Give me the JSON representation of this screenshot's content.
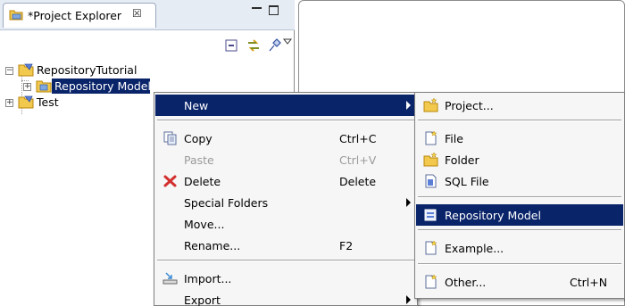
{
  "view": {
    "tab_title": "*Project Explorer",
    "close_glyph": "☒",
    "toolbar": [
      "collapse-all-icon",
      "link-with-editor-icon",
      "pin-icon",
      "view-menu-icon"
    ]
  },
  "tree": {
    "items": [
      {
        "label": "RepositoryTutorial",
        "expander": "−",
        "icon": "project-icon"
      },
      {
        "label": "Repository Models",
        "expander": "+",
        "icon": "folder-icon",
        "selected": true
      },
      {
        "label": "Test",
        "expander": "+",
        "icon": "project-icon"
      }
    ]
  },
  "context_menu": {
    "items": [
      {
        "label": "New",
        "submenu": true,
        "highlighted": true
      },
      {
        "label": "Copy",
        "shortcut": "Ctrl+C",
        "icon": "copy-icon"
      },
      {
        "label": "Paste",
        "shortcut": "Ctrl+V",
        "disabled": true
      },
      {
        "label": "Delete",
        "shortcut": "Delete",
        "icon": "delete-icon"
      },
      {
        "label": "Special Folders",
        "submenu": true
      },
      {
        "label": "Move..."
      },
      {
        "label": "Rename...",
        "shortcut": "F2"
      },
      {
        "label": "Import...",
        "icon": "import-icon"
      },
      {
        "label": "Export",
        "submenu": true
      }
    ]
  },
  "new_submenu": {
    "items": [
      {
        "label": "Project...",
        "icon": "new-project-icon"
      },
      {
        "label": "File",
        "icon": "new-file-icon"
      },
      {
        "label": "Folder",
        "icon": "new-folder-icon"
      },
      {
        "label": "SQL File",
        "icon": "sql-file-icon"
      },
      {
        "label": "Repository Model",
        "icon": "repository-model-icon",
        "highlighted": true
      },
      {
        "label": "Example...",
        "icon": "new-example-icon"
      },
      {
        "label": "Other...",
        "shortcut": "Ctrl+N",
        "icon": "new-other-icon"
      }
    ]
  },
  "colors": {
    "selection": "#0a246a",
    "menu_bg": "#f6f6f6",
    "tab_bg": "#e6ecf4"
  }
}
